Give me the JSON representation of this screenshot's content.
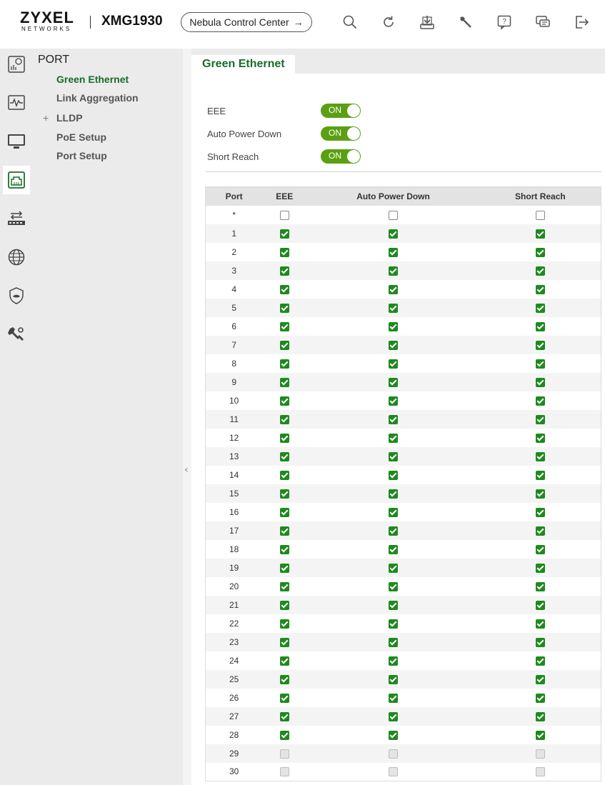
{
  "header": {
    "brand": "ZYXEL",
    "brand_sub": "NETWORKS",
    "model": "XMG1930",
    "nebula_label": "Nebula Control Center",
    "nebula_arrow": "→",
    "icons": [
      "search-icon",
      "refresh-icon",
      "save-icon",
      "maintenance-icon",
      "help-icon",
      "feedback-icon",
      "logout-icon"
    ]
  },
  "rail": {
    "items": [
      "dashboard-icon",
      "monitor-icon",
      "system-icon",
      "port-icon",
      "switching-icon",
      "network-icon",
      "security-icon",
      "maintenance-icon"
    ],
    "active_index": 3
  },
  "sidemenu": {
    "title": "PORT",
    "items": [
      {
        "label": "Green Ethernet"
      },
      {
        "label": "Link Aggregation"
      },
      {
        "label": "LLDP",
        "expand": "+"
      },
      {
        "label": "PoE Setup"
      },
      {
        "label": "Port Setup"
      }
    ],
    "collapse_glyph": "‹"
  },
  "main": {
    "tab_label": "Green Ethernet",
    "toggles": [
      {
        "label": "EEE",
        "state": "ON"
      },
      {
        "label": "Auto Power Down",
        "state": "ON"
      },
      {
        "label": "Short Reach",
        "state": "ON"
      }
    ]
  },
  "table": {
    "columns": [
      "Port",
      "EEE",
      "Auto Power Down",
      "Short Reach"
    ],
    "all_row_label": "*",
    "rows": [
      {
        "port": "1",
        "state": "checked"
      },
      {
        "port": "2",
        "state": "checked"
      },
      {
        "port": "3",
        "state": "checked"
      },
      {
        "port": "4",
        "state": "checked"
      },
      {
        "port": "5",
        "state": "checked"
      },
      {
        "port": "6",
        "state": "checked"
      },
      {
        "port": "7",
        "state": "checked"
      },
      {
        "port": "8",
        "state": "checked"
      },
      {
        "port": "9",
        "state": "checked"
      },
      {
        "port": "10",
        "state": "checked"
      },
      {
        "port": "11",
        "state": "checked"
      },
      {
        "port": "12",
        "state": "checked"
      },
      {
        "port": "13",
        "state": "checked"
      },
      {
        "port": "14",
        "state": "checked"
      },
      {
        "port": "15",
        "state": "checked"
      },
      {
        "port": "16",
        "state": "checked"
      },
      {
        "port": "17",
        "state": "checked"
      },
      {
        "port": "18",
        "state": "checked"
      },
      {
        "port": "19",
        "state": "checked"
      },
      {
        "port": "20",
        "state": "checked"
      },
      {
        "port": "21",
        "state": "checked"
      },
      {
        "port": "22",
        "state": "checked"
      },
      {
        "port": "23",
        "state": "checked"
      },
      {
        "port": "24",
        "state": "checked"
      },
      {
        "port": "25",
        "state": "checked"
      },
      {
        "port": "26",
        "state": "checked"
      },
      {
        "port": "27",
        "state": "checked"
      },
      {
        "port": "28",
        "state": "checked"
      },
      {
        "port": "29",
        "state": "disabled"
      },
      {
        "port": "30",
        "state": "disabled"
      }
    ]
  },
  "colors": {
    "accent_green": "#1a6b2a",
    "toggle_green": "#5aa012",
    "checkbox_green": "#1e8a1e"
  }
}
